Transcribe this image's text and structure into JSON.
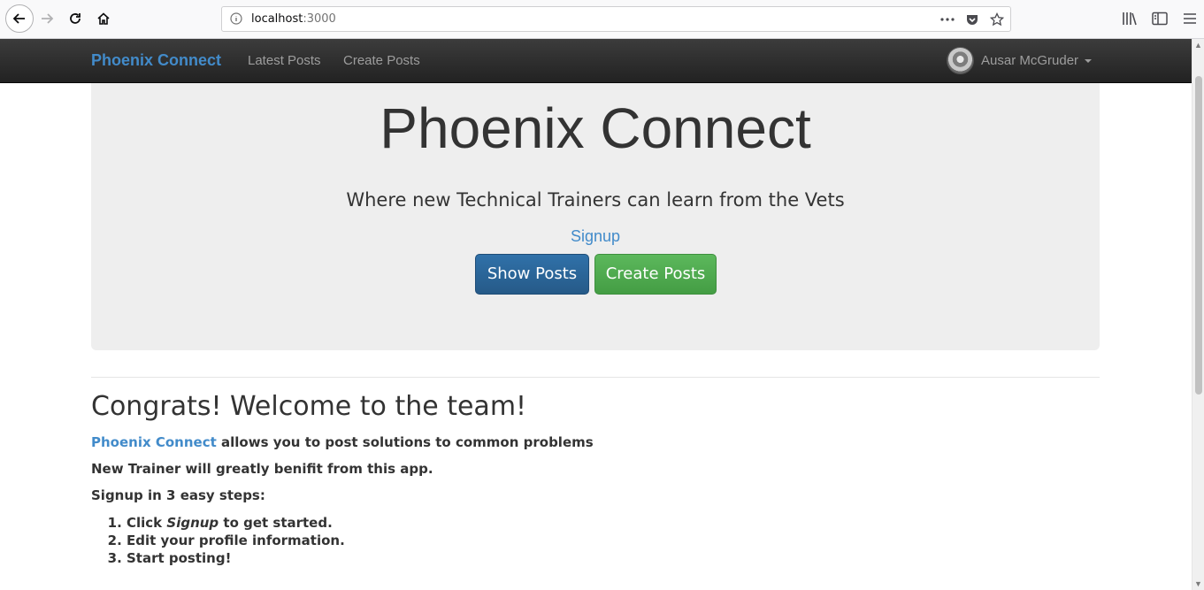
{
  "browser": {
    "url_host": "localhost",
    "url_port": ":3000"
  },
  "navbar": {
    "brand": "Phoenix Connect",
    "links": [
      "Latest Posts",
      "Create Posts"
    ],
    "user_name": "Ausar McGruder"
  },
  "jumbotron": {
    "title": "Phoenix Connect",
    "lead": "Where new Technical Trainers can learn from the Vets",
    "signup_label": "Signup",
    "show_posts_label": "Show Posts",
    "create_posts_label": "Create Posts"
  },
  "content": {
    "heading": "Congrats! Welcome to the team!",
    "intro_link": "Phoenix Connect",
    "intro_rest": " allows you to post solutions to common problems",
    "line2": "New Trainer will greatly benifit from this app.",
    "line3": "Signup in 3 easy steps:",
    "step1_pre": "Click ",
    "step1_em": "Signup",
    "step1_post": " to get started.",
    "step2": "Edit your profile information.",
    "step3": "Start posting!"
  },
  "colors": {
    "brand_blue": "#428bca",
    "navbar_dark": "#222222",
    "jumbotron_bg": "#eeeeee",
    "primary_button": "#265a88",
    "success_button": "#5cb85c"
  },
  "icons": [
    "back-arrow-icon",
    "forward-arrow-icon",
    "reload-icon",
    "home-icon",
    "info-icon",
    "more-dots-icon",
    "pocket-icon",
    "bookmark-star-icon",
    "library-icon",
    "sidebar-icon",
    "hamburger-menu-icon"
  ]
}
